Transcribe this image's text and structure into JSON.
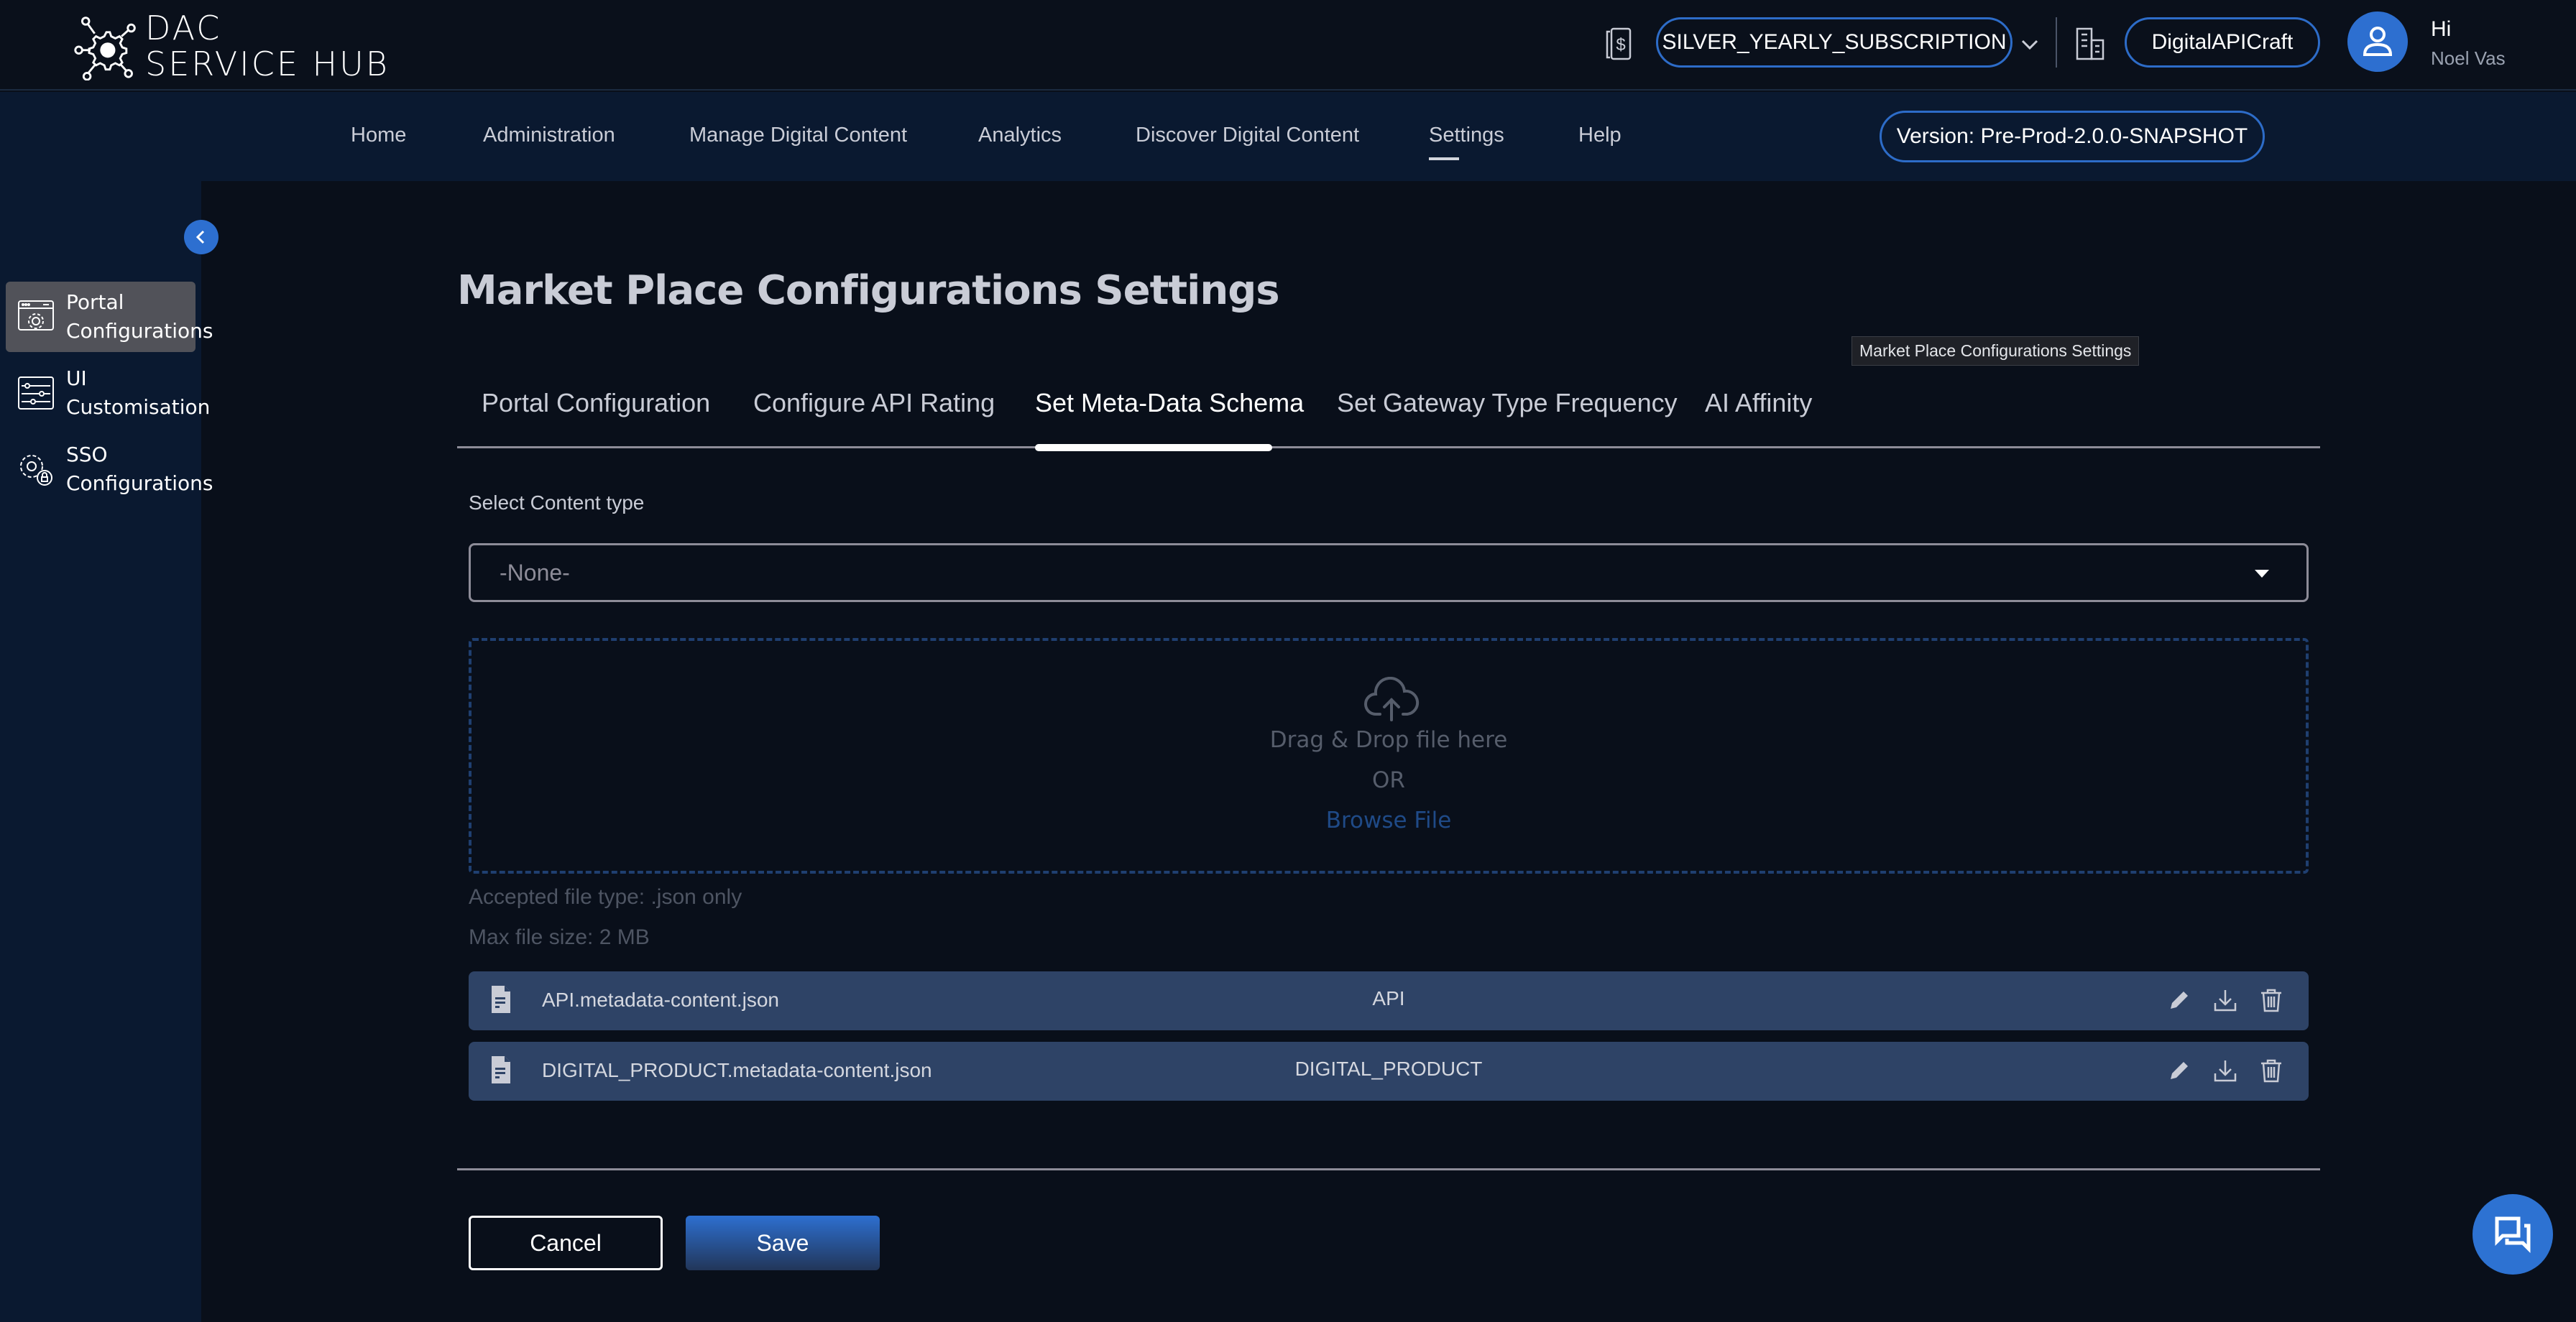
{
  "header": {
    "logo_line1": "DAC",
    "logo_line2": "SERVICE HUB",
    "subscription": "SILVER_YEARLY_SUBSCRIPTION",
    "organization": "DigitalAPICraft",
    "greeting": "Hi",
    "user_name": "Noel Vas",
    "icons": {
      "subscription": "dollar-document-icon",
      "expand": "chevron-down-icon",
      "organization": "building-icon",
      "avatar": "user-avatar-icon"
    }
  },
  "nav": {
    "items": [
      {
        "label": "Home",
        "active": false
      },
      {
        "label": "Administration",
        "active": false
      },
      {
        "label": "Manage Digital Content",
        "active": false
      },
      {
        "label": "Analytics",
        "active": false
      },
      {
        "label": "Discover Digital Content",
        "active": false
      },
      {
        "label": "Settings",
        "active": true
      },
      {
        "label": "Help",
        "active": false
      }
    ],
    "version": "Version: Pre-Prod-2.0.0-SNAPSHOT"
  },
  "sidebar": {
    "collapse_icon": "chevron-left-icon",
    "items": [
      {
        "line1": "Portal",
        "line2": "Configurations",
        "icon": "browser-gear-icon",
        "active": true
      },
      {
        "line1": "UI",
        "line2": "Customisation",
        "icon": "sliders-icon",
        "active": false
      },
      {
        "line1": "SSO",
        "line2": "Configurations",
        "icon": "gear-lock-icon",
        "active": false
      }
    ]
  },
  "main": {
    "title": "Market Place Configurations Settings",
    "tooltip": "Market Place Configurations Settings",
    "tabs": [
      {
        "label": "Portal Configuration",
        "active": false
      },
      {
        "label": "Configure API Rating",
        "active": false
      },
      {
        "label": "Set Meta-Data Schema",
        "active": true
      },
      {
        "label": "Set Gateway Type Frequency",
        "active": false
      },
      {
        "label": "AI Affinity",
        "active": false
      }
    ],
    "content_type": {
      "label": "Select Content type",
      "selected": "-None-"
    },
    "dropzone": {
      "icon": "cloud-upload-icon",
      "text": "Drag & Drop file here",
      "or": "OR",
      "browse": "Browse File"
    },
    "hints": {
      "accepted": "Accepted file type: .json only",
      "max_size": "Max file size: 2 MB"
    },
    "files": [
      {
        "name": "API.metadata-content.json",
        "type": "API"
      },
      {
        "name": "DIGITAL_PRODUCT.metadata-content.json",
        "type": "DIGITAL_PRODUCT"
      }
    ],
    "actions": {
      "cancel": "Cancel",
      "save": "Save"
    }
  },
  "colors": {
    "accent": "#2d6fd0",
    "page_bg": "#090f1a",
    "nav_bg": "#0a1930",
    "file_row_bg": "#2e4366",
    "dropzone_border": "#1f3f70"
  },
  "chat_fab_icon": "chat-bubbles-icon"
}
